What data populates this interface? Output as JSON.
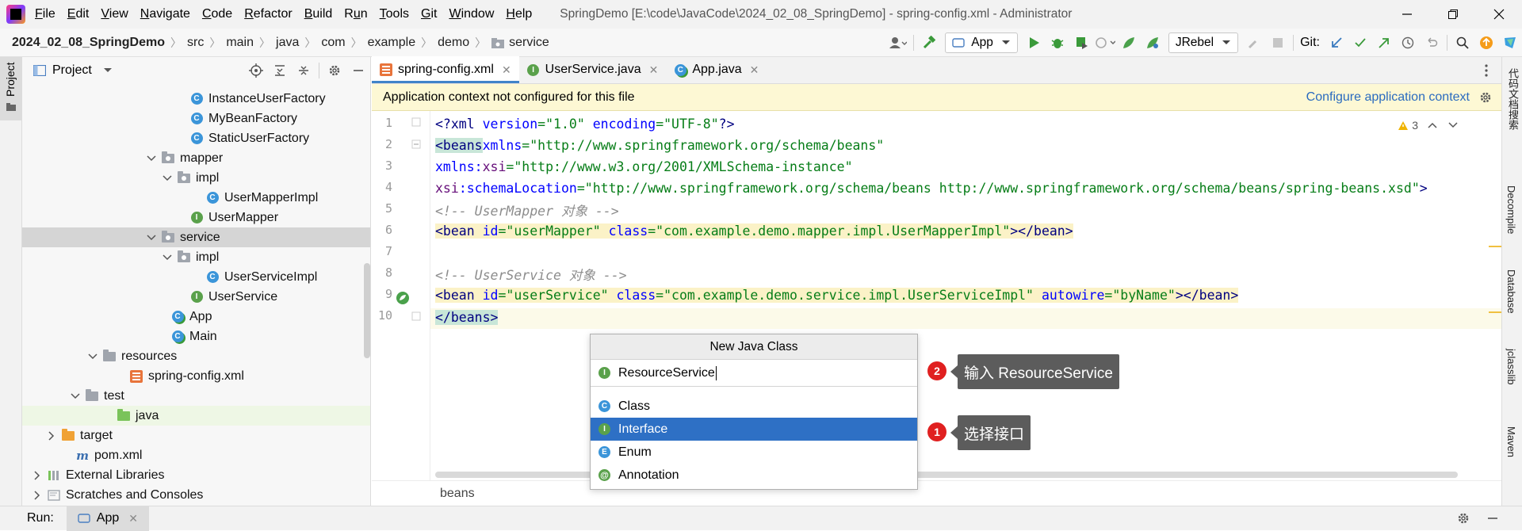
{
  "window": {
    "title": "SpringDemo [E:\\code\\JavaCode\\2024_02_08_SpringDemo] - spring-config.xml - Administrator",
    "menu": [
      {
        "pre": "",
        "u": "F",
        "post": "ile"
      },
      {
        "pre": "",
        "u": "E",
        "post": "dit"
      },
      {
        "pre": "",
        "u": "V",
        "post": "iew"
      },
      {
        "pre": "",
        "u": "N",
        "post": "avigate"
      },
      {
        "pre": "",
        "u": "C",
        "post": "ode"
      },
      {
        "pre": "",
        "u": "R",
        "post": "efactor"
      },
      {
        "pre": "",
        "u": "B",
        "post": "uild"
      },
      {
        "pre": "R",
        "u": "u",
        "post": "n"
      },
      {
        "pre": "",
        "u": "T",
        "post": "ools"
      },
      {
        "pre": "",
        "u": "G",
        "post": "it"
      },
      {
        "pre": "",
        "u": "W",
        "post": "indow"
      },
      {
        "pre": "",
        "u": "H",
        "post": "elp"
      }
    ]
  },
  "breadcrumb": [
    "2024_02_08_SpringDemo",
    "src",
    "main",
    "java",
    "com",
    "example",
    "demo",
    "service"
  ],
  "toolbar": {
    "run_config": "App",
    "jrebel": "JRebel",
    "git_label": "Git:"
  },
  "project": {
    "panel_title": "Project",
    "tree": [
      {
        "label": "InstanceUserFactory",
        "icon": "class",
        "arrow": ""
      },
      {
        "label": "MyBeanFactory",
        "icon": "class",
        "arrow": ""
      },
      {
        "label": "StaticUserFactory",
        "icon": "class",
        "arrow": ""
      },
      {
        "label": "mapper",
        "icon": "package",
        "arrow": "down"
      },
      {
        "label": "impl",
        "icon": "package",
        "arrow": "down"
      },
      {
        "label": "UserMapperImpl",
        "icon": "class",
        "arrow": ""
      },
      {
        "label": "UserMapper",
        "icon": "interface",
        "arrow": ""
      },
      {
        "label": "service",
        "icon": "package",
        "arrow": "down"
      },
      {
        "label": "impl",
        "icon": "package",
        "arrow": "down"
      },
      {
        "label": "UserServiceImpl",
        "icon": "class",
        "arrow": ""
      },
      {
        "label": "UserService",
        "icon": "interface",
        "arrow": ""
      },
      {
        "label": "App",
        "icon": "class-run",
        "arrow": ""
      },
      {
        "label": "Main",
        "icon": "class-run",
        "arrow": ""
      },
      {
        "label": "resources",
        "icon": "resources",
        "arrow": "down"
      },
      {
        "label": "spring-config.xml",
        "icon": "xml",
        "arrow": ""
      },
      {
        "label": "test",
        "icon": "folder",
        "arrow": "down"
      },
      {
        "label": "java",
        "icon": "green-folder",
        "arrow": ""
      },
      {
        "label": "target",
        "icon": "orange-folder",
        "arrow": "right"
      },
      {
        "label": "pom.xml",
        "icon": "maven",
        "arrow": ""
      },
      {
        "label": "External Libraries",
        "icon": "libraries",
        "arrow": "right"
      },
      {
        "label": "Scratches and Consoles",
        "icon": "scratches",
        "arrow": "right"
      }
    ]
  },
  "tabs": [
    {
      "label": "spring-config.xml",
      "icon": "xml"
    },
    {
      "label": "UserService.java",
      "icon": "interface"
    },
    {
      "label": "App.java",
      "icon": "class-run"
    }
  ],
  "banner": {
    "message": "Application context not configured for this file",
    "link": "Configure application context"
  },
  "editor": {
    "warnings": "3",
    "line_numbers": [
      "1",
      "2",
      "3",
      "4",
      "5",
      "6",
      "7",
      "8",
      "9",
      "10"
    ],
    "bottom_crumb": "beans"
  },
  "popup": {
    "title": "New Java Class",
    "input_value": "ResourceService",
    "options": [
      {
        "label": "Class",
        "icon": "C"
      },
      {
        "label": "Interface",
        "icon": "I"
      },
      {
        "label": "Enum",
        "icon": "E"
      },
      {
        "label": "Annotation",
        "icon": "@"
      }
    ]
  },
  "callouts": [
    {
      "num": "2",
      "text": "输入 ResourceService"
    },
    {
      "num": "1",
      "text": "选择接口"
    }
  ],
  "right_stripe": [
    "代码文档搜索",
    "Decompile",
    "Database",
    "jclasslib",
    "Maven"
  ],
  "run_bar": {
    "label": "Run:",
    "tab": "App"
  },
  "colors": {
    "accent": "#2e70c5",
    "banner_bg": "#fdf8d4",
    "callout_bg": "#5c5c5c",
    "badge": "#e02020"
  }
}
